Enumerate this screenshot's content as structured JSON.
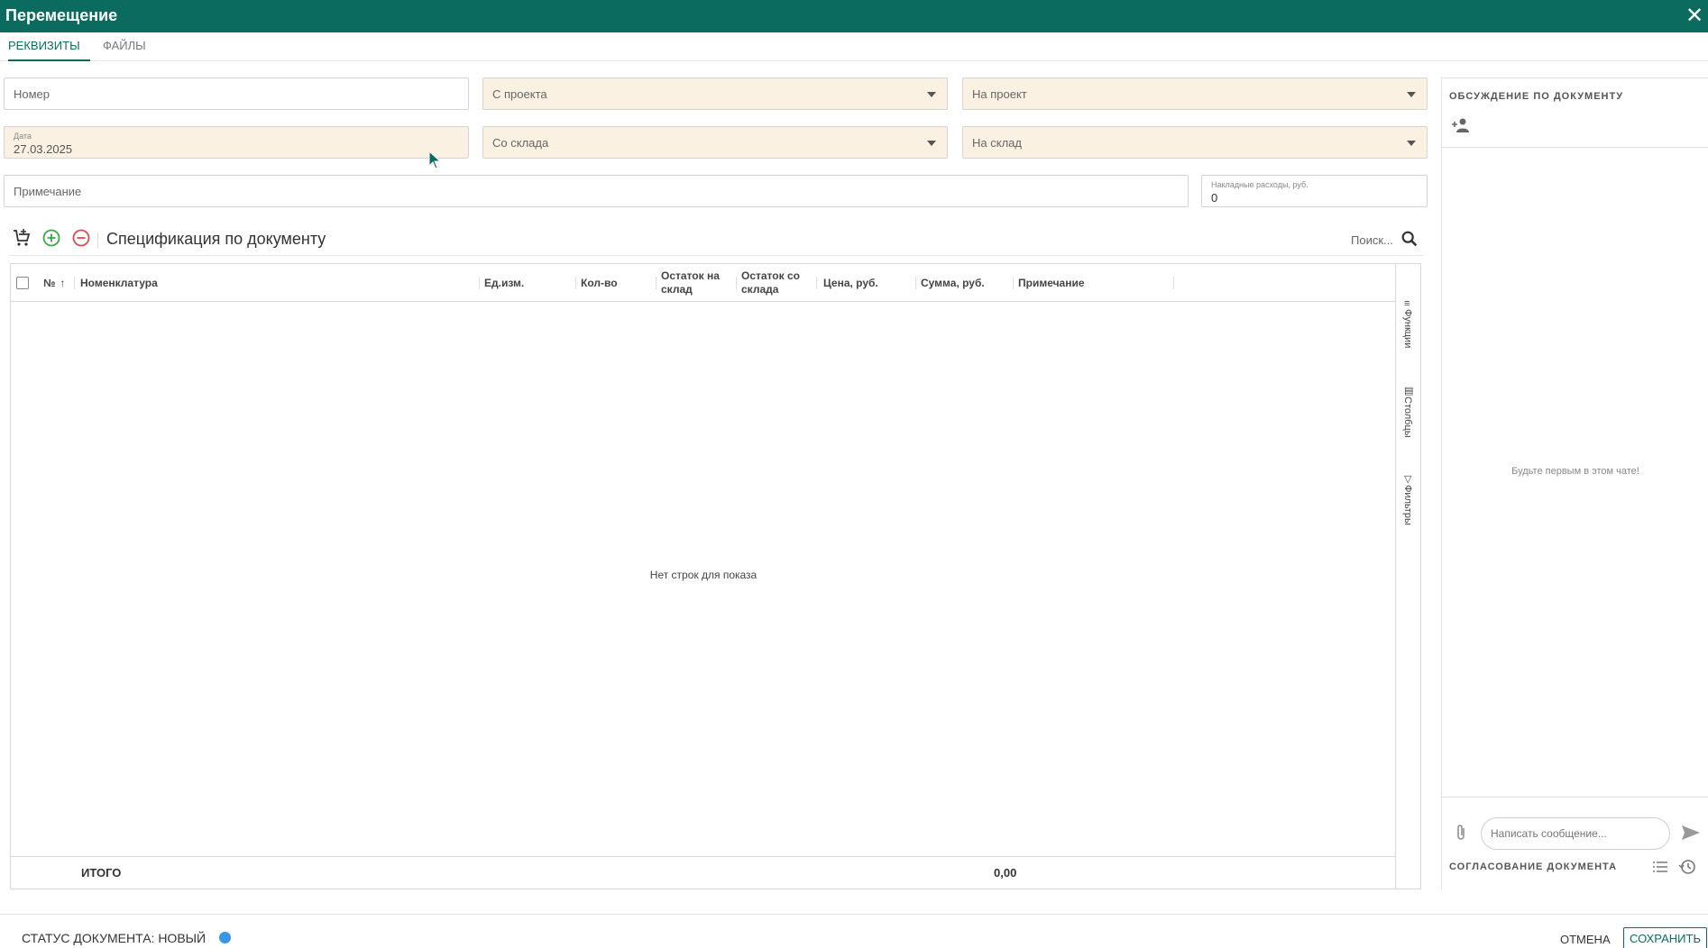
{
  "window": {
    "title": "Перемещение",
    "close_icon": "close-icon"
  },
  "tabs": [
    {
      "label": "РЕКВИЗИТЫ",
      "active": true
    },
    {
      "label": "ФАЙЛЫ",
      "active": false
    }
  ],
  "form": {
    "number": {
      "placeholder": "Номер"
    },
    "from_project": {
      "placeholder": "С проекта"
    },
    "to_project": {
      "placeholder": "На проект"
    },
    "date": {
      "label": "Дата",
      "value": "27.03.2025"
    },
    "from_warehouse": {
      "placeholder": "Со склада"
    },
    "to_warehouse": {
      "placeholder": "На склад"
    },
    "note": {
      "placeholder": "Примечание"
    },
    "overhead": {
      "label": "Накладные расходы, руб.",
      "value": "0"
    }
  },
  "spec": {
    "title": "Спецификация по документу",
    "search_placeholder": "Поиск...",
    "columns": {
      "num": "№",
      "nomenclature": "Номенклатура",
      "unit": "Ед.изм.",
      "qty": "Кол-во",
      "stock_to": "Остаток на склад",
      "stock_from": "Остаток со склада",
      "price": "Цена, руб.",
      "sum": "Сумма, руб.",
      "note": "Примечание"
    },
    "empty_message": "Нет строк для показа",
    "side_panel": {
      "functions": "Функции",
      "columns": "Столбцы",
      "filters": "Фильтры"
    },
    "total_label": "ИТОГО",
    "total_value": "0,00"
  },
  "discussion": {
    "title": "ОБСУЖДЕНИЕ ПО ДОКУМЕНТУ",
    "empty_message": "Будьте первым в этом чате!",
    "message_placeholder": "Написать сообщение...",
    "approval_title": "СОГЛАСОВАНИЕ ДОКУМЕНТА"
  },
  "footer": {
    "status": "СТАТУС ДОКУМЕНТА: НОВЫЙ",
    "status_color": "#3a97e8",
    "cancel_label": "ОТМЕНА",
    "save_label": "СОХРАНИТЬ"
  },
  "colors": {
    "accent": "#0c6b5f",
    "required_field": "#fbf1e3",
    "add": "#3aa84a",
    "remove": "#e04a4a"
  }
}
